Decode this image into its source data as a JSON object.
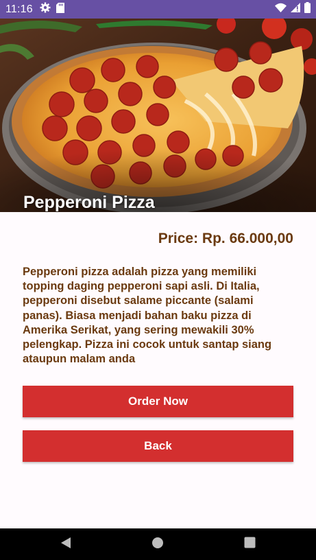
{
  "status_bar": {
    "time": "11:16",
    "left_icons": [
      "gear-icon",
      "sd-card-icon"
    ],
    "right_icons": [
      "wifi-icon",
      "cellular-signal-icon",
      "battery-icon"
    ],
    "background": "#6750a4"
  },
  "product": {
    "name": "Pepperoni Pizza",
    "price": "Price: Rp. 66.000,00",
    "description": "Pepperoni pizza adalah pizza yang memiliki topping daging pepperoni sapi asli. Di Italia, pepperoni disebut salame piccante (salami panas). Biasa menjadi bahan baku pizza di Amerika Serikat, yang sering mewakili 30% pelengkap. Pizza ini cocok untuk santap siang ataupun malam anda"
  },
  "actions": {
    "order_label": "Order Now",
    "back_label": "Back"
  },
  "nav_bar": {
    "icons": [
      "back-triangle-icon",
      "home-circle-icon",
      "recents-square-icon"
    ]
  },
  "colors": {
    "accent": "#d32f2f",
    "text_brown": "#6b3a10",
    "background": "#fffbfe"
  }
}
